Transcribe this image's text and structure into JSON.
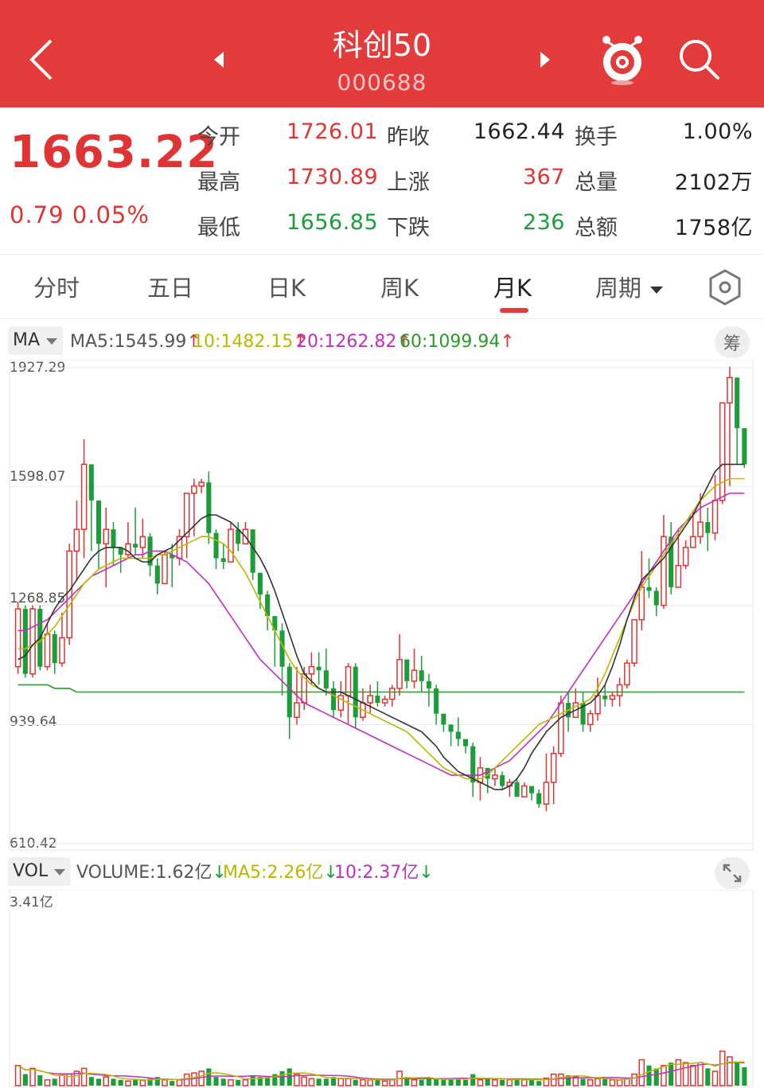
{
  "header": {
    "title": "科创50",
    "code": "000688",
    "bg_color": "#e33b3b",
    "icons": [
      "back-chevron-icon",
      "prev-triangle-icon",
      "next-triangle-icon",
      "mascot-icon",
      "search-icon"
    ]
  },
  "quote": {
    "price": "1663.22",
    "change": "0.79",
    "change_pct": "0.05%",
    "fields": [
      {
        "label": "今开",
        "value": "1726.01",
        "color": "red"
      },
      {
        "label": "昨收",
        "value": "1662.44",
        "color": "black"
      },
      {
        "label": "换手",
        "value": "1.00%",
        "color": "black"
      },
      {
        "label": "最高",
        "value": "1730.89",
        "color": "red"
      },
      {
        "label": "上涨",
        "value": "367",
        "color": "red"
      },
      {
        "label": "总量",
        "value": "2102万",
        "color": "black"
      },
      {
        "label": "最低",
        "value": "1656.85",
        "color": "green"
      },
      {
        "label": "下跌",
        "value": "236",
        "color": "green"
      },
      {
        "label": "总额",
        "value": "1758亿",
        "color": "black"
      }
    ]
  },
  "tabs": [
    {
      "label": "分时",
      "active": false
    },
    {
      "label": "五日",
      "active": false
    },
    {
      "label": "日K",
      "active": false
    },
    {
      "label": "周K",
      "active": false
    },
    {
      "label": "月K",
      "active": true
    },
    {
      "label": "周期",
      "active": false
    }
  ],
  "ma_legend": {
    "select": "MA",
    "ma5": "MA5:1545.99",
    "ma10": "10:1482.15",
    "ma20": "20:1262.82",
    "ma60": "60:1099.94",
    "chip_button": "筹",
    "colors": {
      "ma5": "#333333",
      "ma10": "#b8b800",
      "ma20": "#c030c0",
      "ma60": "#2a9a2a"
    }
  },
  "vol_legend": {
    "select": "VOL",
    "volume": "VOLUME:1.62亿",
    "ma5": "MA5:2.26亿",
    "ma10": "10:2.37亿"
  },
  "chart_data": {
    "type": "candlestick",
    "price_axis": {
      "ticks": [
        "1927.29",
        "1598.07",
        "1268.85",
        "939.64",
        "610.42"
      ],
      "ylim": [
        610.42,
        1927.29
      ]
    },
    "volume_axis": {
      "ticks": [
        "3.41亿"
      ],
      "ylim": [
        0,
        3.41
      ]
    },
    "up_color": "#e03434",
    "down_color": "#1b9e3a",
    "candles": [
      [
        1100,
        1260,
        1280,
        1080,
        0.35
      ],
      [
        1260,
        1080,
        1270,
        1070,
        0.2
      ],
      [
        1080,
        1260,
        1270,
        1070,
        0.3
      ],
      [
        1260,
        1100,
        1270,
        1090,
        0.18
      ],
      [
        1100,
        1190,
        1220,
        1090,
        0.1
      ],
      [
        1190,
        1110,
        1200,
        1080,
        0.12
      ],
      [
        1110,
        1180,
        1250,
        1100,
        0.18
      ],
      [
        1180,
        1420,
        1440,
        1160,
        0.2
      ],
      [
        1420,
        1480,
        1560,
        1340,
        0.25
      ],
      [
        1480,
        1660,
        1730,
        1400,
        0.3
      ],
      [
        1660,
        1560,
        1620,
        1420,
        0.15
      ],
      [
        1560,
        1440,
        1560,
        1370,
        0.12
      ],
      [
        1440,
        1480,
        1540,
        1320,
        0.15
      ],
      [
        1480,
        1430,
        1500,
        1380,
        0.12
      ],
      [
        1430,
        1410,
        1430,
        1360,
        0.1
      ],
      [
        1410,
        1440,
        1500,
        1400,
        0.08
      ],
      [
        1440,
        1430,
        1540,
        1410,
        0.1
      ],
      [
        1430,
        1460,
        1510,
        1400,
        0.09
      ],
      [
        1460,
        1380,
        1470,
        1350,
        0.12
      ],
      [
        1380,
        1330,
        1400,
        1300,
        0.15
      ],
      [
        1330,
        1410,
        1420,
        1330,
        0.1
      ],
      [
        1410,
        1400,
        1440,
        1320,
        0.08
      ],
      [
        1400,
        1460,
        1480,
        1380,
        0.1
      ],
      [
        1460,
        1580,
        1580,
        1400,
        0.2
      ],
      [
        1580,
        1600,
        1620,
        1460,
        0.22
      ],
      [
        1600,
        1610,
        1620,
        1580,
        0.25
      ],
      [
        1610,
        1470,
        1640,
        1440,
        0.3
      ],
      [
        1470,
        1400,
        1480,
        1370,
        0.15
      ],
      [
        1400,
        1390,
        1440,
        1370,
        0.12
      ],
      [
        1390,
        1480,
        1500,
        1390,
        0.1
      ],
      [
        1480,
        1440,
        1500,
        1420,
        0.1
      ],
      [
        1440,
        1480,
        1500,
        1440,
        0.1
      ],
      [
        1480,
        1360,
        1480,
        1340,
        0.18
      ],
      [
        1360,
        1300,
        1340,
        1260,
        0.15
      ],
      [
        1300,
        1240,
        1310,
        1200,
        0.15
      ],
      [
        1240,
        1200,
        1240,
        1100,
        0.2
      ],
      [
        1200,
        1100,
        1220,
        1020,
        0.25
      ],
      [
        1100,
        960,
        1110,
        900,
        0.3
      ],
      [
        960,
        1000,
        1100,
        940,
        0.2
      ],
      [
        1000,
        1080,
        1100,
        980,
        0.15
      ],
      [
        1080,
        1100,
        1140,
        1050,
        0.12
      ],
      [
        1100,
        1090,
        1140,
        1050,
        0.12
      ],
      [
        1090,
        1040,
        1150,
        1020,
        0.12
      ],
      [
        1040,
        980,
        1060,
        960,
        0.15
      ],
      [
        980,
        1020,
        1060,
        960,
        0.12
      ],
      [
        1020,
        1100,
        1110,
        940,
        0.12
      ],
      [
        1100,
        960,
        1110,
        930,
        0.1
      ],
      [
        960,
        1000,
        1040,
        950,
        0.1
      ],
      [
        1000,
        1020,
        1050,
        970,
        0.1
      ],
      [
        1020,
        1000,
        1060,
        990,
        0.1
      ],
      [
        1000,
        1010,
        1020,
        990,
        0.08
      ],
      [
        1010,
        1040,
        1050,
        990,
        0.1
      ],
      [
        1040,
        1120,
        1190,
        1020,
        0.25
      ],
      [
        1120,
        1060,
        1120,
        1040,
        0.15
      ],
      [
        1060,
        1090,
        1150,
        1040,
        0.1
      ],
      [
        1090,
        1060,
        1130,
        1030,
        0.1
      ],
      [
        1060,
        1040,
        1080,
        990,
        0.12
      ],
      [
        1040,
        970,
        1050,
        940,
        0.12
      ],
      [
        970,
        940,
        960,
        920,
        0.1
      ],
      [
        940,
        920,
        940,
        880,
        0.12
      ],
      [
        920,
        900,
        960,
        880,
        0.12
      ],
      [
        900,
        880,
        900,
        860,
        0.1
      ],
      [
        880,
        780,
        890,
        740,
        0.2
      ],
      [
        780,
        820,
        850,
        730,
        0.1
      ],
      [
        820,
        790,
        800,
        750,
        0.12
      ],
      [
        790,
        800,
        820,
        770,
        0.1
      ],
      [
        800,
        770,
        810,
        760,
        0.1
      ],
      [
        770,
        780,
        790,
        740,
        0.1
      ],
      [
        780,
        740,
        790,
        740,
        0.12
      ],
      [
        740,
        770,
        780,
        750,
        0.1
      ],
      [
        770,
        750,
        760,
        730,
        0.1
      ],
      [
        750,
        720,
        760,
        710,
        0.08
      ],
      [
        720,
        780,
        860,
        700,
        0.13
      ],
      [
        780,
        860,
        880,
        720,
        0.2
      ],
      [
        860,
        1000,
        1020,
        850,
        0.2
      ],
      [
        1000,
        960,
        1030,
        920,
        0.18
      ],
      [
        960,
        1000,
        1040,
        970,
        0.15
      ],
      [
        1000,
        940,
        1030,
        920,
        0.12
      ],
      [
        940,
        970,
        980,
        920,
        0.1
      ],
      [
        970,
        1020,
        1070,
        950,
        0.12
      ],
      [
        1020,
        1010,
        1050,
        990,
        0.12
      ],
      [
        1010,
        1020,
        1030,
        990,
        0.1
      ],
      [
        1020,
        1050,
        1070,
        990,
        0.1
      ],
      [
        1050,
        1110,
        1120,
        1040,
        0.12
      ],
      [
        1110,
        1230,
        1230,
        1100,
        0.2
      ],
      [
        1230,
        1320,
        1420,
        1200,
        0.45
      ],
      [
        1320,
        1310,
        1400,
        1290,
        0.35
      ],
      [
        1310,
        1270,
        1320,
        1240,
        0.3
      ],
      [
        1270,
        1460,
        1520,
        1260,
        0.35
      ],
      [
        1460,
        1320,
        1500,
        1300,
        0.4
      ],
      [
        1320,
        1380,
        1480,
        1320,
        0.45
      ],
      [
        1380,
        1430,
        1450,
        1370,
        0.4
      ],
      [
        1430,
        1460,
        1530,
        1430,
        0.35
      ],
      [
        1460,
        1500,
        1580,
        1440,
        0.4
      ],
      [
        1500,
        1470,
        1540,
        1420,
        0.3
      ],
      [
        1470,
        1560,
        1630,
        1450,
        0.25
      ],
      [
        1560,
        1830,
        1830,
        1550,
        0.6
      ],
      [
        1830,
        1900,
        1930,
        1600,
        0.5
      ],
      [
        1900,
        1760,
        1900,
        1660,
        0.4
      ],
      [
        1760,
        1660,
        1730,
        1650,
        0.32
      ]
    ],
    "ma_lines": {
      "ma5": [
        1120,
        1130,
        1160,
        1180,
        1220,
        1260,
        1290,
        1310,
        1340,
        1370,
        1400,
        1420,
        1430,
        1430,
        1430,
        1420,
        1400,
        1390,
        1390,
        1410,
        1420,
        1430,
        1450,
        1470,
        1490,
        1510,
        1520,
        1520,
        1510,
        1500,
        1480,
        1460,
        1430,
        1400,
        1360,
        1310,
        1250,
        1190,
        1130,
        1080,
        1060,
        1040,
        1030,
        1030,
        1030,
        1020,
        1010,
        1000,
        990,
        980,
        970,
        960,
        950,
        940,
        930,
        920,
        900,
        880,
        850,
        830,
        810,
        800,
        790,
        780,
        770,
        760,
        760,
        770,
        790,
        820,
        860,
        890,
        920,
        940,
        960,
        970,
        980,
        990,
        1000,
        1020,
        1050,
        1100,
        1160,
        1230,
        1290,
        1340,
        1360,
        1380,
        1400,
        1430,
        1460,
        1490,
        1520,
        1560,
        1600,
        1640,
        1660,
        1660,
        1660,
        1660
      ],
      "ma10": [
        1150,
        1150,
        1160,
        1170,
        1190,
        1210,
        1240,
        1270,
        1300,
        1330,
        1350,
        1370,
        1380,
        1390,
        1400,
        1400,
        1400,
        1400,
        1400,
        1410,
        1410,
        1420,
        1430,
        1440,
        1450,
        1460,
        1460,
        1450,
        1440,
        1420,
        1390,
        1360,
        1320,
        1280,
        1240,
        1200,
        1160,
        1120,
        1090,
        1070,
        1050,
        1040,
        1030,
        1020,
        1010,
        1000,
        990,
        980,
        970,
        960,
        950,
        940,
        930,
        920,
        900,
        880,
        860,
        840,
        820,
        810,
        800,
        790,
        790,
        790,
        800,
        820,
        840,
        860,
        880,
        900,
        920,
        940,
        950,
        960,
        970,
        980,
        990,
        1000,
        1010,
        1040,
        1080,
        1130,
        1180,
        1230,
        1280,
        1320,
        1350,
        1380,
        1410,
        1440,
        1470,
        1500,
        1530,
        1560,
        1580,
        1600,
        1610,
        1620,
        1620,
        1620
      ],
      "ma20": [
        1200,
        1200,
        1210,
        1220,
        1230,
        1250,
        1270,
        1290,
        1310,
        1330,
        1350,
        1360,
        1370,
        1380,
        1390,
        1400,
        1410,
        1410,
        1420,
        1420,
        1420,
        1410,
        1400,
        1390,
        1370,
        1350,
        1330,
        1300,
        1270,
        1240,
        1210,
        1180,
        1150,
        1120,
        1100,
        1080,
        1060,
        1040,
        1020,
        1000,
        990,
        980,
        970,
        960,
        950,
        940,
        930,
        920,
        910,
        900,
        890,
        880,
        870,
        860,
        850,
        840,
        830,
        820,
        810,
        800,
        800,
        800,
        800,
        800,
        810,
        820,
        830,
        840,
        860,
        880,
        900,
        920,
        940,
        970,
        1000,
        1030,
        1060,
        1090,
        1120,
        1150,
        1180,
        1210,
        1240,
        1270,
        1300,
        1330,
        1360,
        1390,
        1420,
        1450,
        1480,
        1500,
        1520,
        1540,
        1550,
        1560,
        1570,
        1580,
        1580,
        1580
      ],
      "ma60": [
        1050,
        1050,
        1050,
        1050,
        1050,
        1040,
        1040,
        1040,
        1030,
        1030,
        1030,
        1030,
        1030,
        1030,
        1030,
        1030,
        1030,
        1030,
        1030,
        1030,
        1030,
        1030,
        1030,
        1030,
        1030,
        1030,
        1030,
        1030,
        1030,
        1030,
        1030,
        1030,
        1030,
        1030,
        1030,
        1030,
        1030,
        1030,
        1030,
        1030,
        1030,
        1030,
        1030,
        1030,
        1030,
        1030,
        1030,
        1030,
        1030,
        1030,
        1030,
        1030,
        1030,
        1030,
        1030,
        1030,
        1030,
        1030,
        1030,
        1030,
        1030,
        1030,
        1030,
        1030,
        1030,
        1030,
        1030,
        1030,
        1030,
        1030,
        1030,
        1030,
        1030,
        1030,
        1030,
        1030,
        1030,
        1030,
        1030,
        1030,
        1030,
        1030,
        1030,
        1030,
        1030,
        1030,
        1030,
        1030,
        1030,
        1030,
        1030,
        1030,
        1030,
        1030,
        1030,
        1030,
        1030,
        1030,
        1030,
        1030
      ]
    }
  }
}
